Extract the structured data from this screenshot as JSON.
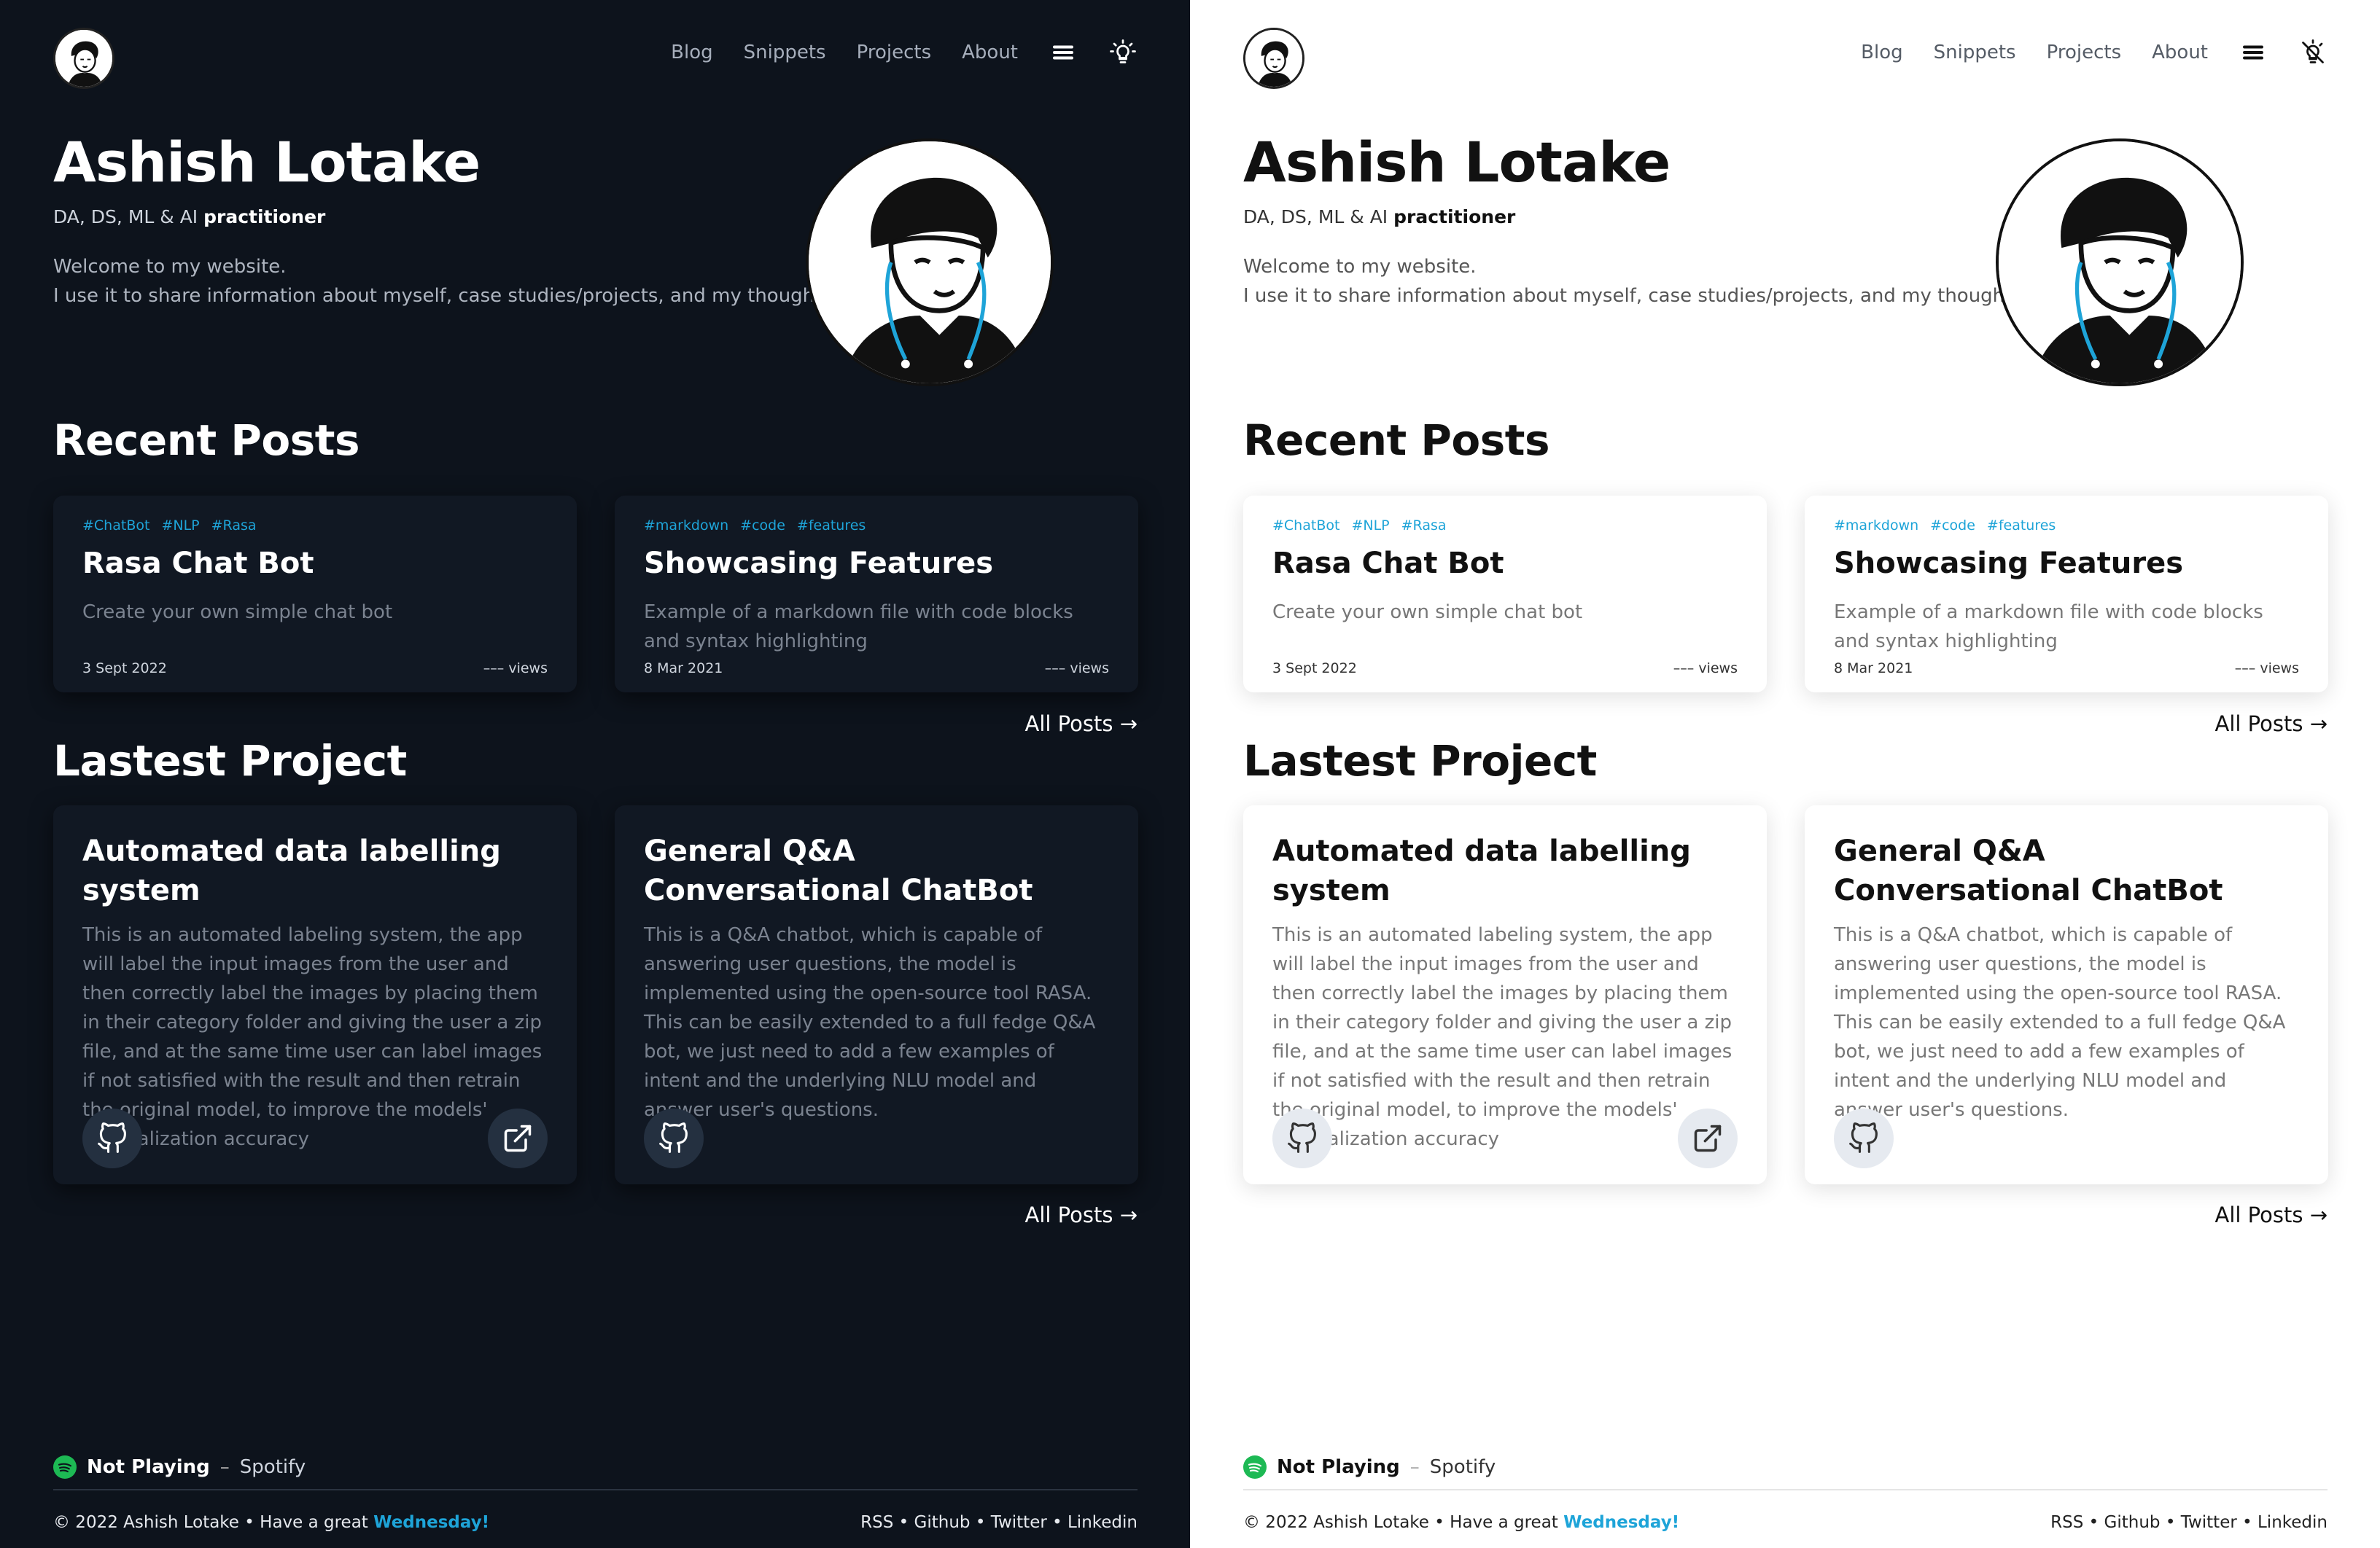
{
  "nav": {
    "items": [
      "Blog",
      "Snippets",
      "Projects",
      "About"
    ],
    "menu_icon": "hamburger-icon",
    "theme_icon_dark": "bulb-icon",
    "theme_icon_light": "bug-icon"
  },
  "hero": {
    "name": "Ashish Lotake",
    "subtitle_prefix": "DA, DS, ML & AI ",
    "subtitle_bold": "practitioner",
    "welcome_line1": "Welcome to my website.",
    "welcome_line2": "I use it to share information about myself, case studies/projects, and my thoughts."
  },
  "recent_posts": {
    "title": "Recent Posts",
    "posts": [
      {
        "tags": [
          "#ChatBot",
          "#NLP",
          "#Rasa"
        ],
        "title": "Rasa Chat Bot",
        "description": "Create your own simple chat bot",
        "date": "3 Sept 2022",
        "views": "––– views"
      },
      {
        "tags": [
          "#markdown",
          "#code",
          "#features"
        ],
        "title": "Showcasing Features",
        "description": "Example of a markdown file with code blocks and syntax highlighting",
        "date": "8 Mar 2021",
        "views": "––– views"
      }
    ],
    "all_link": "All Posts →"
  },
  "projects": {
    "title": "Lastest Project",
    "items": [
      {
        "title": "Automated data labelling system",
        "description": "This is an automated labeling system, the app will label the input images from the user and then correctly label the images by placing them in their category folder and giving the user a zip file, and at the same time user can label images if not satisfied with the result and then retrain the original model, to improve the models' generalization accuracy",
        "github_icon": "github-icon",
        "external_icon": "external-link-icon"
      },
      {
        "title": "General Q&A Conversational ChatBot",
        "description": "This is a Q&A chatbot, which is capable of answering user questions, the model is implemented using the open-source tool RASA. This can be easily extended to a full fedge Q&A bot, we just need to add a few examples of intent and the underlying NLU model and answer user's questions.",
        "github_icon": "github-icon"
      }
    ],
    "all_link": "All Posts →"
  },
  "spotify": {
    "status": "Not Playing",
    "separator": "–",
    "service": "Spotify",
    "icon": "spotify-icon",
    "color": "#1db954"
  },
  "footer": {
    "copyright": "© 2022 Ashish Lotake • Have a great ",
    "day": "Wednesday!",
    "links": "RSS • Github • Twitter • Linkedin"
  },
  "colors": {
    "dark_bg": "#0d131c",
    "light_bg": "#ffffff",
    "accent": "#1ea4d8"
  }
}
